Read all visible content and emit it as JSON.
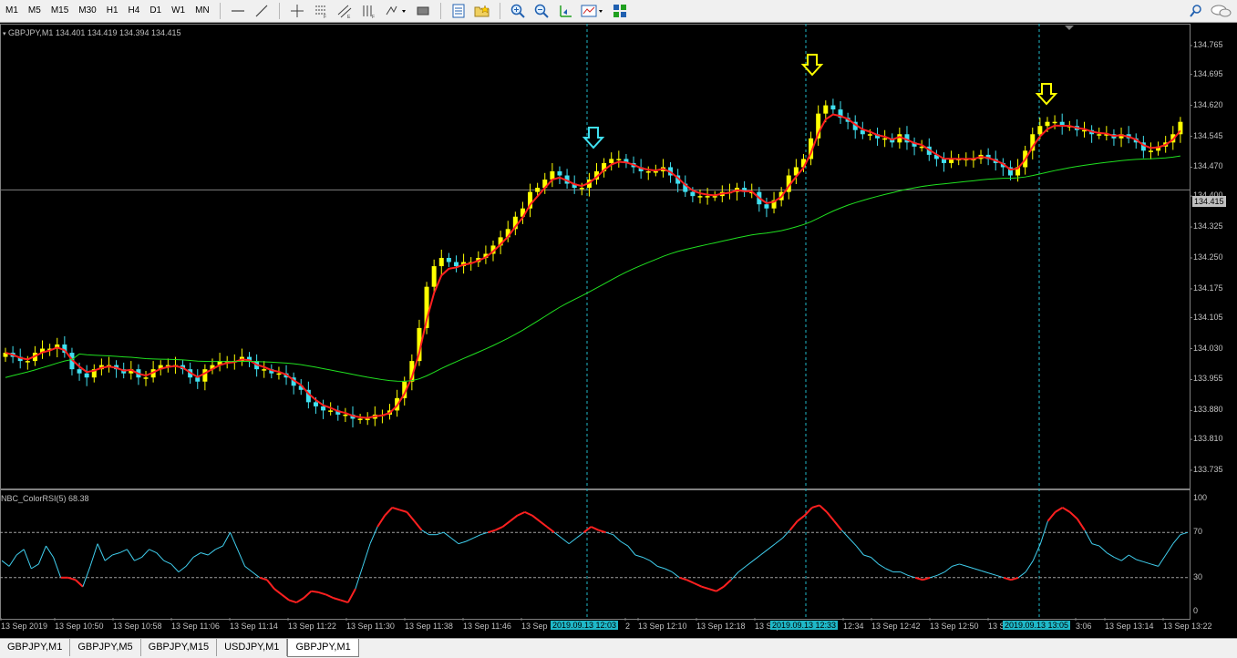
{
  "toolbar": {
    "timeframes": [
      "M1",
      "M5",
      "M15",
      "M30",
      "H1",
      "H4",
      "D1",
      "W1",
      "MN"
    ],
    "icons": [
      "horizontal-line-icon",
      "trend-line-icon",
      "crosshair-icon",
      "fibonacci-icon",
      "channel-icon",
      "fibonacci-fan-icon",
      "arrow-tool-icon",
      "chart-bar-icon",
      "template-icon",
      "favorite-folder-icon",
      "zoom-in-icon",
      "zoom-out-icon",
      "chart-shift-icon",
      "indicators-icon",
      "tile-windows-icon",
      "search-icon",
      "chat-icon"
    ]
  },
  "main_pane": {
    "label": "GBPJPY,M1  134.401 134.419 134.394 134.415",
    "current_price": "134.415",
    "price_levels": [
      "134.765",
      "134.695",
      "134.620",
      "134.545",
      "134.470",
      "134.400",
      "134.325",
      "134.250",
      "134.175",
      "134.105",
      "134.030",
      "133.955",
      "133.880",
      "133.810",
      "133.735"
    ]
  },
  "indicator_pane": {
    "label": "NBC_ColorRSI(5) 68.38",
    "levels": [
      "100",
      "70",
      "30",
      "0"
    ]
  },
  "time_axis": {
    "labels": [
      "13 Sep 2019",
      "13 Sep 10:50",
      "13 Sep 10:58",
      "13 Sep 11:06",
      "13 Sep 11:14",
      "13 Sep 11:22",
      "13 Sep 11:30",
      "13 Sep 11:38",
      "13 Sep 11:46",
      "13 Sep",
      "2",
      "13 Sep 12:10",
      "13 Sep 12:18",
      "13 Sep 12:26",
      "12:34",
      "13 Sep 12:42",
      "13 Sep 12:50",
      "13 S",
      "3:06",
      "13 Sep 13:14",
      "13 Sep 13:22"
    ],
    "highlights": [
      "2019.09.13 12:03",
      "2019.09.13 12:33",
      "2019.09.13 13:05"
    ]
  },
  "tabs": [
    {
      "label": "GBPJPY,M1",
      "active": false
    },
    {
      "label": "GBPJPY,M5",
      "active": false
    },
    {
      "label": "GBPJPY,M15",
      "active": false
    },
    {
      "label": "USDJPY,M1",
      "active": false
    },
    {
      "label": "GBPJPY,M1",
      "active": true
    }
  ],
  "colors": {
    "bull": "#ffff00",
    "bear": "#40e0f0",
    "ma_fast": "#ff2020",
    "ma_slow": "#20e020",
    "rsi_normal": "#40d0f0",
    "rsi_extreme": "#ff2020",
    "grid_level": "#a0a0a0",
    "vline": "#1fb8c8"
  },
  "chart_data": {
    "type": "candlestick",
    "symbol": "GBPJPY",
    "timeframe": "M1",
    "ylim": [
      133.735,
      134.765
    ],
    "close": [
      134.02,
      134.01,
      134.0,
      134.0,
      134.02,
      134.03,
      134.03,
      134.04,
      134.02,
      133.98,
      133.97,
      133.96,
      133.98,
      133.99,
      133.99,
      133.98,
      133.97,
      133.98,
      133.96,
      133.96,
      133.98,
      133.99,
      133.99,
      133.99,
      133.98,
      133.96,
      133.95,
      133.98,
      133.99,
      134.0,
      134.0,
      134.0,
      134.01,
      134.0,
      133.98,
      133.98,
      133.97,
      133.97,
      133.96,
      133.94,
      133.93,
      133.9,
      133.89,
      133.88,
      133.88,
      133.87,
      133.87,
      133.86,
      133.86,
      133.86,
      133.87,
      133.87,
      133.88,
      133.91,
      133.95,
      134.0,
      134.08,
      134.18,
      134.23,
      134.25,
      134.24,
      134.23,
      134.24,
      134.24,
      134.25,
      134.26,
      134.28,
      134.3,
      134.32,
      134.35,
      134.37,
      134.41,
      134.42,
      134.44,
      134.46,
      134.45,
      134.43,
      134.42,
      134.42,
      134.44,
      134.46,
      134.48,
      134.49,
      134.49,
      134.48,
      134.47,
      134.46,
      134.46,
      134.46,
      134.47,
      134.45,
      134.43,
      134.41,
      134.4,
      134.4,
      134.4,
      134.4,
      134.41,
      134.41,
      134.42,
      134.41,
      134.41,
      134.38,
      134.37,
      134.39,
      134.41,
      134.45,
      134.47,
      134.49,
      134.54,
      134.6,
      134.62,
      134.61,
      134.59,
      134.58,
      134.56,
      134.55,
      134.55,
      134.54,
      134.54,
      134.53,
      134.55,
      134.53,
      134.52,
      134.52,
      134.5,
      134.49,
      134.48,
      134.49,
      134.49,
      134.49,
      134.49,
      134.5,
      134.49,
      134.48,
      134.47,
      134.45,
      134.47,
      134.51,
      134.55,
      134.57,
      134.58,
      134.58,
      134.57,
      134.57,
      134.56,
      134.56,
      134.55,
      134.55,
      134.55,
      134.54,
      134.55,
      134.54,
      134.53,
      134.51,
      134.51,
      134.52,
      134.53,
      134.55,
      134.58
    ],
    "rsi": [
      45,
      40,
      50,
      55,
      38,
      42,
      58,
      48,
      30,
      30,
      28,
      22,
      40,
      60,
      45,
      50,
      52,
      55,
      45,
      48,
      55,
      52,
      45,
      42,
      35,
      40,
      48,
      52,
      50,
      55,
      58,
      70,
      55,
      40,
      35,
      30,
      28,
      20,
      15,
      10,
      8,
      12,
      18,
      17,
      15,
      12,
      10,
      8,
      20,
      40,
      60,
      75,
      85,
      92,
      90,
      88,
      80,
      72,
      68,
      68,
      70,
      65,
      60,
      62,
      65,
      68,
      70,
      72,
      75,
      80,
      85,
      88,
      85,
      80,
      75,
      70,
      65,
      60,
      65,
      70,
      75,
      72,
      70,
      68,
      62,
      58,
      50,
      48,
      45,
      40,
      38,
      35,
      30,
      28,
      25,
      22,
      20,
      18,
      22,
      28,
      35,
      40,
      45,
      50,
      55,
      60,
      65,
      72,
      80,
      85,
      92,
      94,
      88,
      80,
      72,
      65,
      58,
      50,
      48,
      42,
      38,
      35,
      35,
      32,
      30,
      28,
      30,
      32,
      35,
      40,
      42,
      40,
      38,
      36,
      34,
      32,
      30,
      28,
      30,
      35,
      45,
      60,
      80,
      88,
      92,
      88,
      82,
      72,
      60,
      58,
      52,
      48,
      45,
      50,
      46,
      44,
      42,
      40,
      50,
      60,
      68,
      70
    ]
  }
}
